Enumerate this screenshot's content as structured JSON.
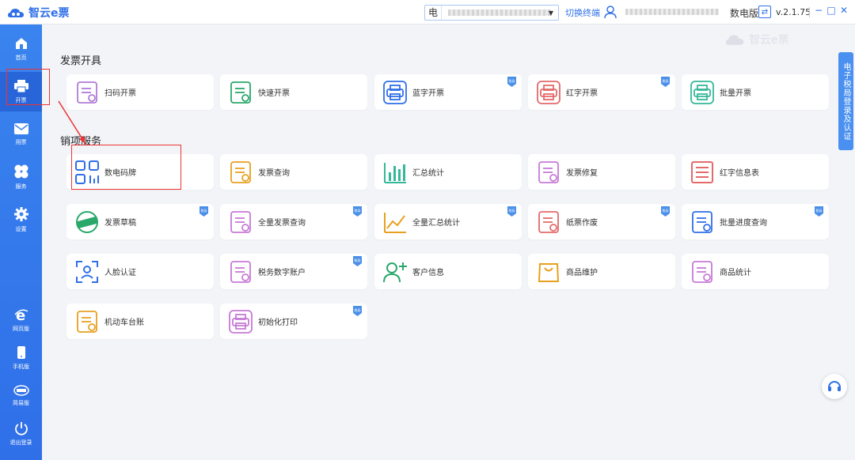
{
  "titlebar": {
    "app_name": "智云e票",
    "company_tag": "电",
    "switch_label": "切换终端",
    "version_type": "数电版",
    "version": "v.2.1.75",
    "minimize": "−",
    "maximize": "□",
    "close": "✕"
  },
  "sidebar": {
    "items": [
      {
        "label": "首页",
        "icon": "home-icon"
      },
      {
        "label": "开票",
        "icon": "invoice-printer-icon"
      },
      {
        "label": "用票",
        "icon": "mail-icon"
      },
      {
        "label": "服务",
        "icon": "clover-icon"
      },
      {
        "label": "设置",
        "icon": "gear-icon"
      },
      {
        "label": "网页版",
        "icon": "ie-browser-icon"
      },
      {
        "label": "手机版",
        "icon": "phone-icon"
      },
      {
        "label": "简易版",
        "icon": "simple-version-icon"
      },
      {
        "label": "退出登录",
        "icon": "power-icon"
      }
    ]
  },
  "watermark": "智云e票",
  "sections": [
    {
      "title": "发票开具",
      "cards": [
        {
          "label": "扫码开票",
          "icon": "qr-invoice-icon",
          "badge": false,
          "color": "#b07bd8"
        },
        {
          "label": "快速开票",
          "icon": "fast-invoice-icon",
          "badge": false,
          "color": "#2aa86a"
        },
        {
          "label": "蓝字开票",
          "icon": "blue-print-icon",
          "badge": true,
          "color": "#2f6fe8"
        },
        {
          "label": "红字开票",
          "icon": "red-print-icon",
          "badge": true,
          "color": "#e46a6a"
        },
        {
          "label": "批量开票",
          "icon": "batch-print-icon",
          "badge": false,
          "color": "#35b89a"
        }
      ]
    },
    {
      "title": "销项服务",
      "cards": [
        {
          "label": "数电码牌",
          "icon": "qr-grid-icon",
          "badge": false,
          "color": "#2f6fe8"
        },
        {
          "label": "发票查询",
          "icon": "invoice-search-icon",
          "badge": false,
          "color": "#e8a020"
        },
        {
          "label": "汇总统计",
          "icon": "bar-chart-icon",
          "badge": false,
          "color": "#35b89a"
        },
        {
          "label": "发票修复",
          "icon": "invoice-repair-icon",
          "badge": false,
          "color": "#c77ad6"
        },
        {
          "label": "红字信息表",
          "icon": "list-icon",
          "badge": false,
          "color": "#e46a6a"
        },
        {
          "label": "发票草稿",
          "icon": "draft-stamp-icon",
          "badge": true,
          "color": "#2aa86a"
        },
        {
          "label": "全量发票查询",
          "icon": "doc-search-icon",
          "badge": true,
          "color": "#c77ad6"
        },
        {
          "label": "全量汇总统计",
          "icon": "line-chart-icon",
          "badge": true,
          "color": "#e8a020"
        },
        {
          "label": "纸票作废",
          "icon": "void-invoice-icon",
          "badge": true,
          "color": "#e46a6a"
        },
        {
          "label": "批量进度查询",
          "icon": "progress-search-icon",
          "badge": true,
          "color": "#2f6fe8"
        },
        {
          "label": "人脸认证",
          "icon": "face-id-icon",
          "badge": false,
          "color": "#2f6fe8"
        },
        {
          "label": "税务数字账户",
          "icon": "tax-account-icon",
          "badge": true,
          "color": "#c77ad6"
        },
        {
          "label": "客户信息",
          "icon": "add-user-icon",
          "badge": false,
          "color": "#2aa86a"
        },
        {
          "label": "商品维护",
          "icon": "bag-icon",
          "badge": false,
          "color": "#e8a020"
        },
        {
          "label": "商品统计",
          "icon": "product-stats-icon",
          "badge": false,
          "color": "#c77ad6"
        },
        {
          "label": "机动车台账",
          "icon": "vehicle-ledger-icon",
          "badge": false,
          "color": "#e8a020"
        },
        {
          "label": "初始化打印",
          "icon": "init-print-icon",
          "badge": true,
          "color": "#c77ad6"
        }
      ]
    }
  ],
  "badge_label": "税局",
  "right_tab": "电子税局登录及认证",
  "colors": {
    "primary": "#2f6fe8",
    "sidebar": "#3a84ef",
    "highlight": "#e33333"
  }
}
